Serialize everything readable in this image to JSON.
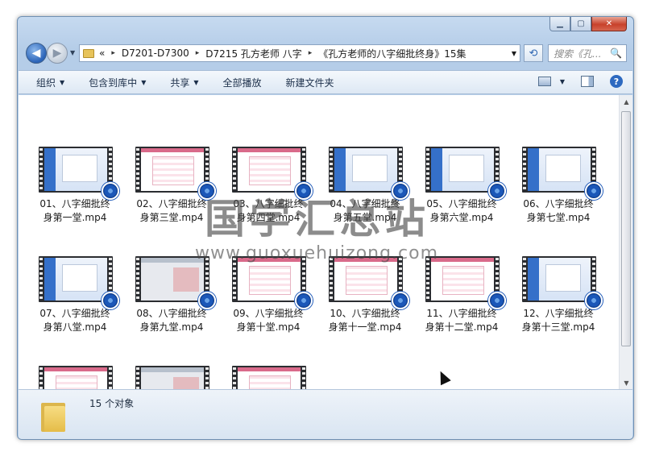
{
  "window": {
    "min_icon": "minimize-icon",
    "max_icon": "maximize-icon",
    "close_icon": "close-icon"
  },
  "nav": {
    "back_glyph": "◀",
    "forward_glyph": "▶",
    "breadcrumb": [
      "«",
      "D7201-D7300",
      "D7215 孔方老师 八字",
      "《孔方老师的八字细批终身》15集"
    ],
    "separator": "▸",
    "search_placeholder": "搜索《孔...",
    "search_icon": "🔍",
    "refresh_glyph": "⟲"
  },
  "toolbar": {
    "organize": "组织",
    "include_library": "包含到库中",
    "share": "共享",
    "play_all": "全部播放",
    "new_folder": "新建文件夹",
    "dropdown_glyph": "▼",
    "help_glyph": "?"
  },
  "files": [
    {
      "line1": "01、八字细批终",
      "line2": "身第一堂.mp4",
      "style": "blue"
    },
    {
      "line1": "02、八字细批终",
      "line2": "身第三堂.mp4",
      "style": "pink"
    },
    {
      "line1": "03、八字细批终",
      "line2": "身第四堂.mp4",
      "style": "pink"
    },
    {
      "line1": "04、八字细批终",
      "line2": "身第五堂.mp4",
      "style": "blue"
    },
    {
      "line1": "05、八字细批终",
      "line2": "身第六堂.mp4",
      "style": "blue"
    },
    {
      "line1": "06、八字细批终",
      "line2": "身第七堂.mp4",
      "style": "blue"
    },
    {
      "line1": "07、八字细批终",
      "line2": "身第八堂.mp4",
      "style": "blue"
    },
    {
      "line1": "08、八字细批终",
      "line2": "身第九堂.mp4",
      "style": "grey"
    },
    {
      "line1": "09、八字细批终",
      "line2": "身第十堂.mp4",
      "style": "pink"
    },
    {
      "line1": "10、八字细批终",
      "line2": "身第十一堂.mp4",
      "style": "pink"
    },
    {
      "line1": "11、八字细批终",
      "line2": "身第十二堂.mp4",
      "style": "pink"
    },
    {
      "line1": "12、八字细批终",
      "line2": "身第十三堂.mp4",
      "style": "blue"
    },
    {
      "line1": "",
      "line2": "",
      "style": "pink"
    },
    {
      "line1": "",
      "line2": "",
      "style": "grey"
    },
    {
      "line1": "",
      "line2": "",
      "style": "pink"
    }
  ],
  "status": {
    "count": "15 个对象"
  },
  "watermark": {
    "title": "国学汇总站",
    "url": "www.guoxuehuizong.com"
  }
}
